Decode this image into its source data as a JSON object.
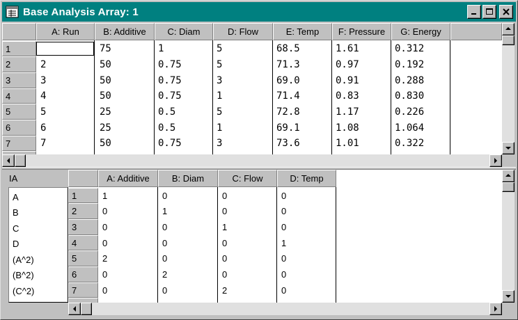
{
  "window": {
    "title": "Base Analysis Array: 1"
  },
  "top_grid": {
    "columns": [
      "A: Run",
      "B: Additive",
      "C: Diam",
      "D: Flow",
      "E: Temp",
      "F: Pressure",
      "G: Energy"
    ],
    "row_labels": [
      "1",
      "2",
      "3",
      "4",
      "5",
      "6",
      "7"
    ],
    "rows": [
      [
        "",
        "75",
        "1",
        "5",
        "68.5",
        "1.61",
        "0.312"
      ],
      [
        "2",
        "50",
        "0.75",
        "5",
        "71.3",
        "0.97",
        "0.192"
      ],
      [
        "3",
        "50",
        "0.75",
        "3",
        "69.0",
        "0.91",
        "0.288"
      ],
      [
        "4",
        "50",
        "0.75",
        "1",
        "71.4",
        "0.83",
        "0.830"
      ],
      [
        "5",
        "25",
        "0.5",
        "5",
        "72.8",
        "1.17",
        "0.226"
      ],
      [
        "6",
        "25",
        "0.5",
        "1",
        "69.1",
        "1.08",
        "1.064"
      ],
      [
        "7",
        "50",
        "0.75",
        "3",
        "73.6",
        "1.01",
        "0.322"
      ]
    ]
  },
  "bottom": {
    "list_header": "IA",
    "list_items": [
      "A",
      "B",
      "C",
      "D",
      "(A^2)",
      "(B^2)",
      "(C^2)"
    ],
    "columns": [
      "A: Additive",
      "B: Diam",
      "C: Flow",
      "D: Temp"
    ],
    "row_labels": [
      "1",
      "2",
      "3",
      "4",
      "5",
      "6",
      "7"
    ],
    "rows": [
      [
        "1",
        "0",
        "0",
        "0"
      ],
      [
        "0",
        "1",
        "0",
        "0"
      ],
      [
        "0",
        "0",
        "1",
        "0"
      ],
      [
        "0",
        "0",
        "0",
        "1"
      ],
      [
        "2",
        "0",
        "0",
        "0"
      ],
      [
        "0",
        "2",
        "0",
        "0"
      ],
      [
        "0",
        "0",
        "2",
        "0"
      ]
    ]
  },
  "icons": [
    "app-icon",
    "minimize-icon",
    "maximize-icon",
    "close-icon",
    "scroll-up-icon",
    "scroll-down-icon",
    "scroll-left-icon",
    "scroll-right-icon"
  ]
}
